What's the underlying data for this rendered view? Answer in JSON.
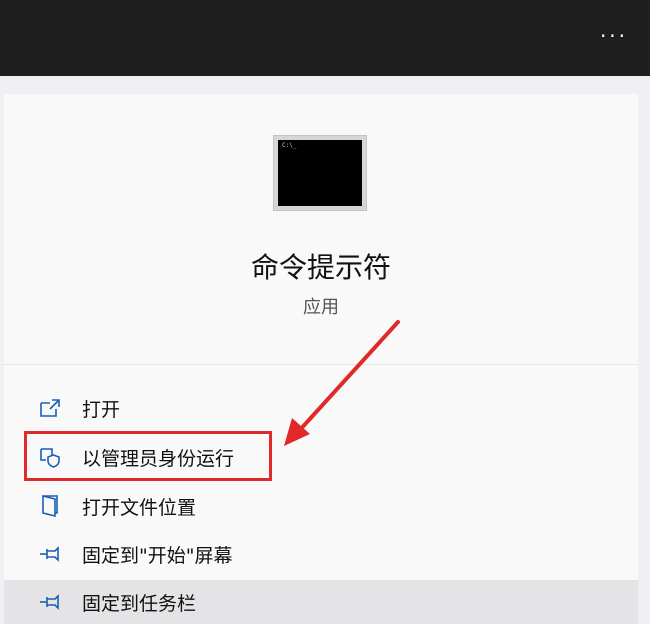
{
  "topbar": {
    "more_label": "···"
  },
  "app": {
    "tile_text": "C:\\_",
    "name": "命令提示符",
    "type": "应用"
  },
  "menu": {
    "items": [
      {
        "label": "打开",
        "icon": "open-external-icon"
      },
      {
        "label": "以管理员身份运行",
        "icon": "shield-icon"
      },
      {
        "label": "打开文件位置",
        "icon": "file-location-icon"
      },
      {
        "label": "固定到\"开始\"屏幕",
        "icon": "pin-icon"
      },
      {
        "label": "固定到任务栏",
        "icon": "pin-icon"
      }
    ]
  },
  "colors": {
    "topbar": "#1f1f1f",
    "panel": "#f9f9fa",
    "icon": "#1a5fb4",
    "highlight": "#e02a2a",
    "hover": "#e4e4e6"
  }
}
